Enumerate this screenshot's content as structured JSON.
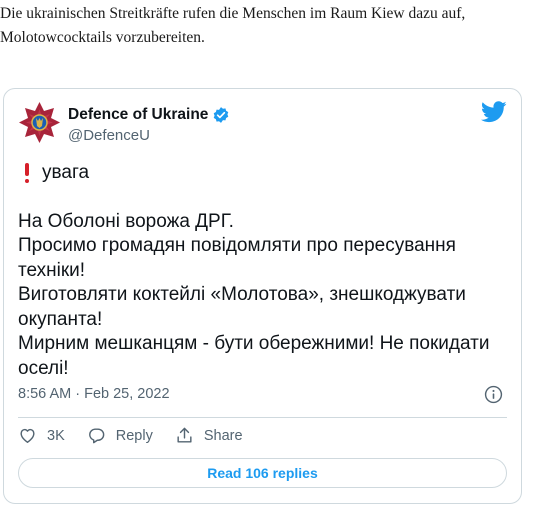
{
  "article": {
    "text": "Die ukrainischen Streitkräfte rufen die Menschen im Raum Kiew dazu auf, Molotowcocktails vorzubereiten."
  },
  "tweet": {
    "display_name": "Defence of Ukraine",
    "handle": "@DefenceU",
    "warning_label": "увага",
    "lines": [
      "На Оболоні ворожа ДРГ.",
      "Просимо громадян повідомляти про пересування техніки!",
      "Виготовляти коктейлі «Молотова», знешкоджувати окупанта!",
      "Мирним мешканцям - бути обережними! Не покидати оселі!"
    ],
    "timestamp": "8:56 AM · Feb 25, 2022",
    "likes": "3K",
    "reply_label": "Reply",
    "share_label": "Share",
    "read_replies_label": "Read 106 replies"
  },
  "icons": {
    "avatar": "ukraine-armed-forces-emblem",
    "verified": "verified-badge-icon",
    "twitter": "twitter-bird-icon",
    "warning": "red-exclamation-icon",
    "info": "info-icon",
    "like": "heart-icon",
    "reply": "speech-bubble-icon",
    "share": "share-upload-icon"
  },
  "colors": {
    "twitter_blue": "#1d9bf0",
    "emblem_red": "#a8243a",
    "emblem_gold": "#d9b44a",
    "muted_text": "#536471",
    "warning_red": "#d6202a"
  }
}
